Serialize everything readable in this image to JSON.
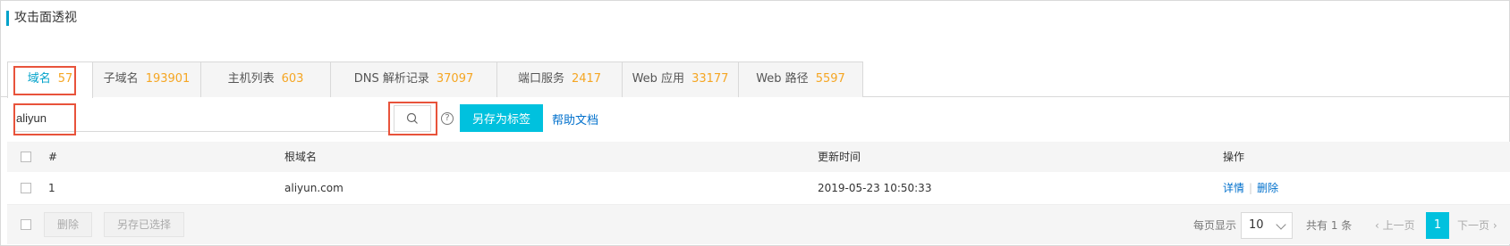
{
  "header": {
    "title": "攻击面透视"
  },
  "tabs": [
    {
      "label": "域名",
      "count": "57"
    },
    {
      "label": "子域名",
      "count": "193901"
    },
    {
      "label": "主机列表",
      "count": "603"
    },
    {
      "label": "DNS 解析记录",
      "count": "37097"
    },
    {
      "label": "端口服务",
      "count": "2417"
    },
    {
      "label": "Web 应用",
      "count": "33177"
    },
    {
      "label": "Web 路径",
      "count": "5597"
    }
  ],
  "search": {
    "value": "aliyun",
    "help_mark": "?",
    "save_tag_label": "另存为标签",
    "help_doc_label": "帮助文档"
  },
  "table": {
    "columns": [
      "#",
      "根域名",
      "更新时间",
      "操作"
    ],
    "rows": [
      {
        "index": "1",
        "root_domain": "aliyun.com",
        "updated": "2019-05-23 10:50:33",
        "actions": [
          "详情",
          "删除"
        ]
      }
    ]
  },
  "footer": {
    "delete_label": "删除",
    "save_selected_label": "另存已选择",
    "per_page_label": "每页显示",
    "page_size": "10",
    "total_label": "共有 1 条",
    "prev_label": "上一页",
    "current_page": "1",
    "next_label": "下一页"
  },
  "colors": {
    "accent": "#00c1de",
    "link": "#0070cc",
    "count": "#f5a623",
    "highlight": "#e8533b"
  }
}
